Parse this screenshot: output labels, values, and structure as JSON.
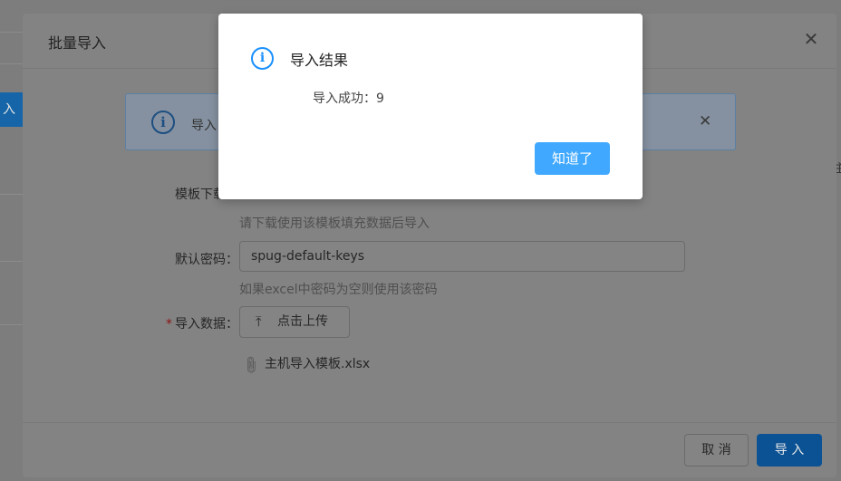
{
  "background": {
    "left_button_label": "入",
    "right_fragment": "主"
  },
  "import_modal": {
    "title": "批量导入",
    "close_icon": "close-icon",
    "alert": {
      "icon": "info-icon",
      "text": "导入"
    },
    "form": {
      "template_label": "模板下载：",
      "template_help": "请下载使用该模板填充数据后导入",
      "password_label": "默认密码：",
      "password_value": "spug-default-keys",
      "password_help": "如果excel中密码为空则使用该密码",
      "data_label": "导入数据：",
      "required_mark": "*",
      "upload_label": "点击上传",
      "upload_icon": "upload-icon",
      "file_icon": "paperclip-icon",
      "file_name": "主机导入模板.xlsx"
    },
    "footer": {
      "cancel_label": "取 消",
      "ok_label": "导 入"
    }
  },
  "result_dialog": {
    "icon": "info-icon",
    "title": "导入结果",
    "content": "导入成功：9",
    "button_label": "知道了"
  },
  "colors": {
    "primary": "#1890ff",
    "dialog_button": "#40a9ff",
    "required": "#ff4d4f"
  }
}
